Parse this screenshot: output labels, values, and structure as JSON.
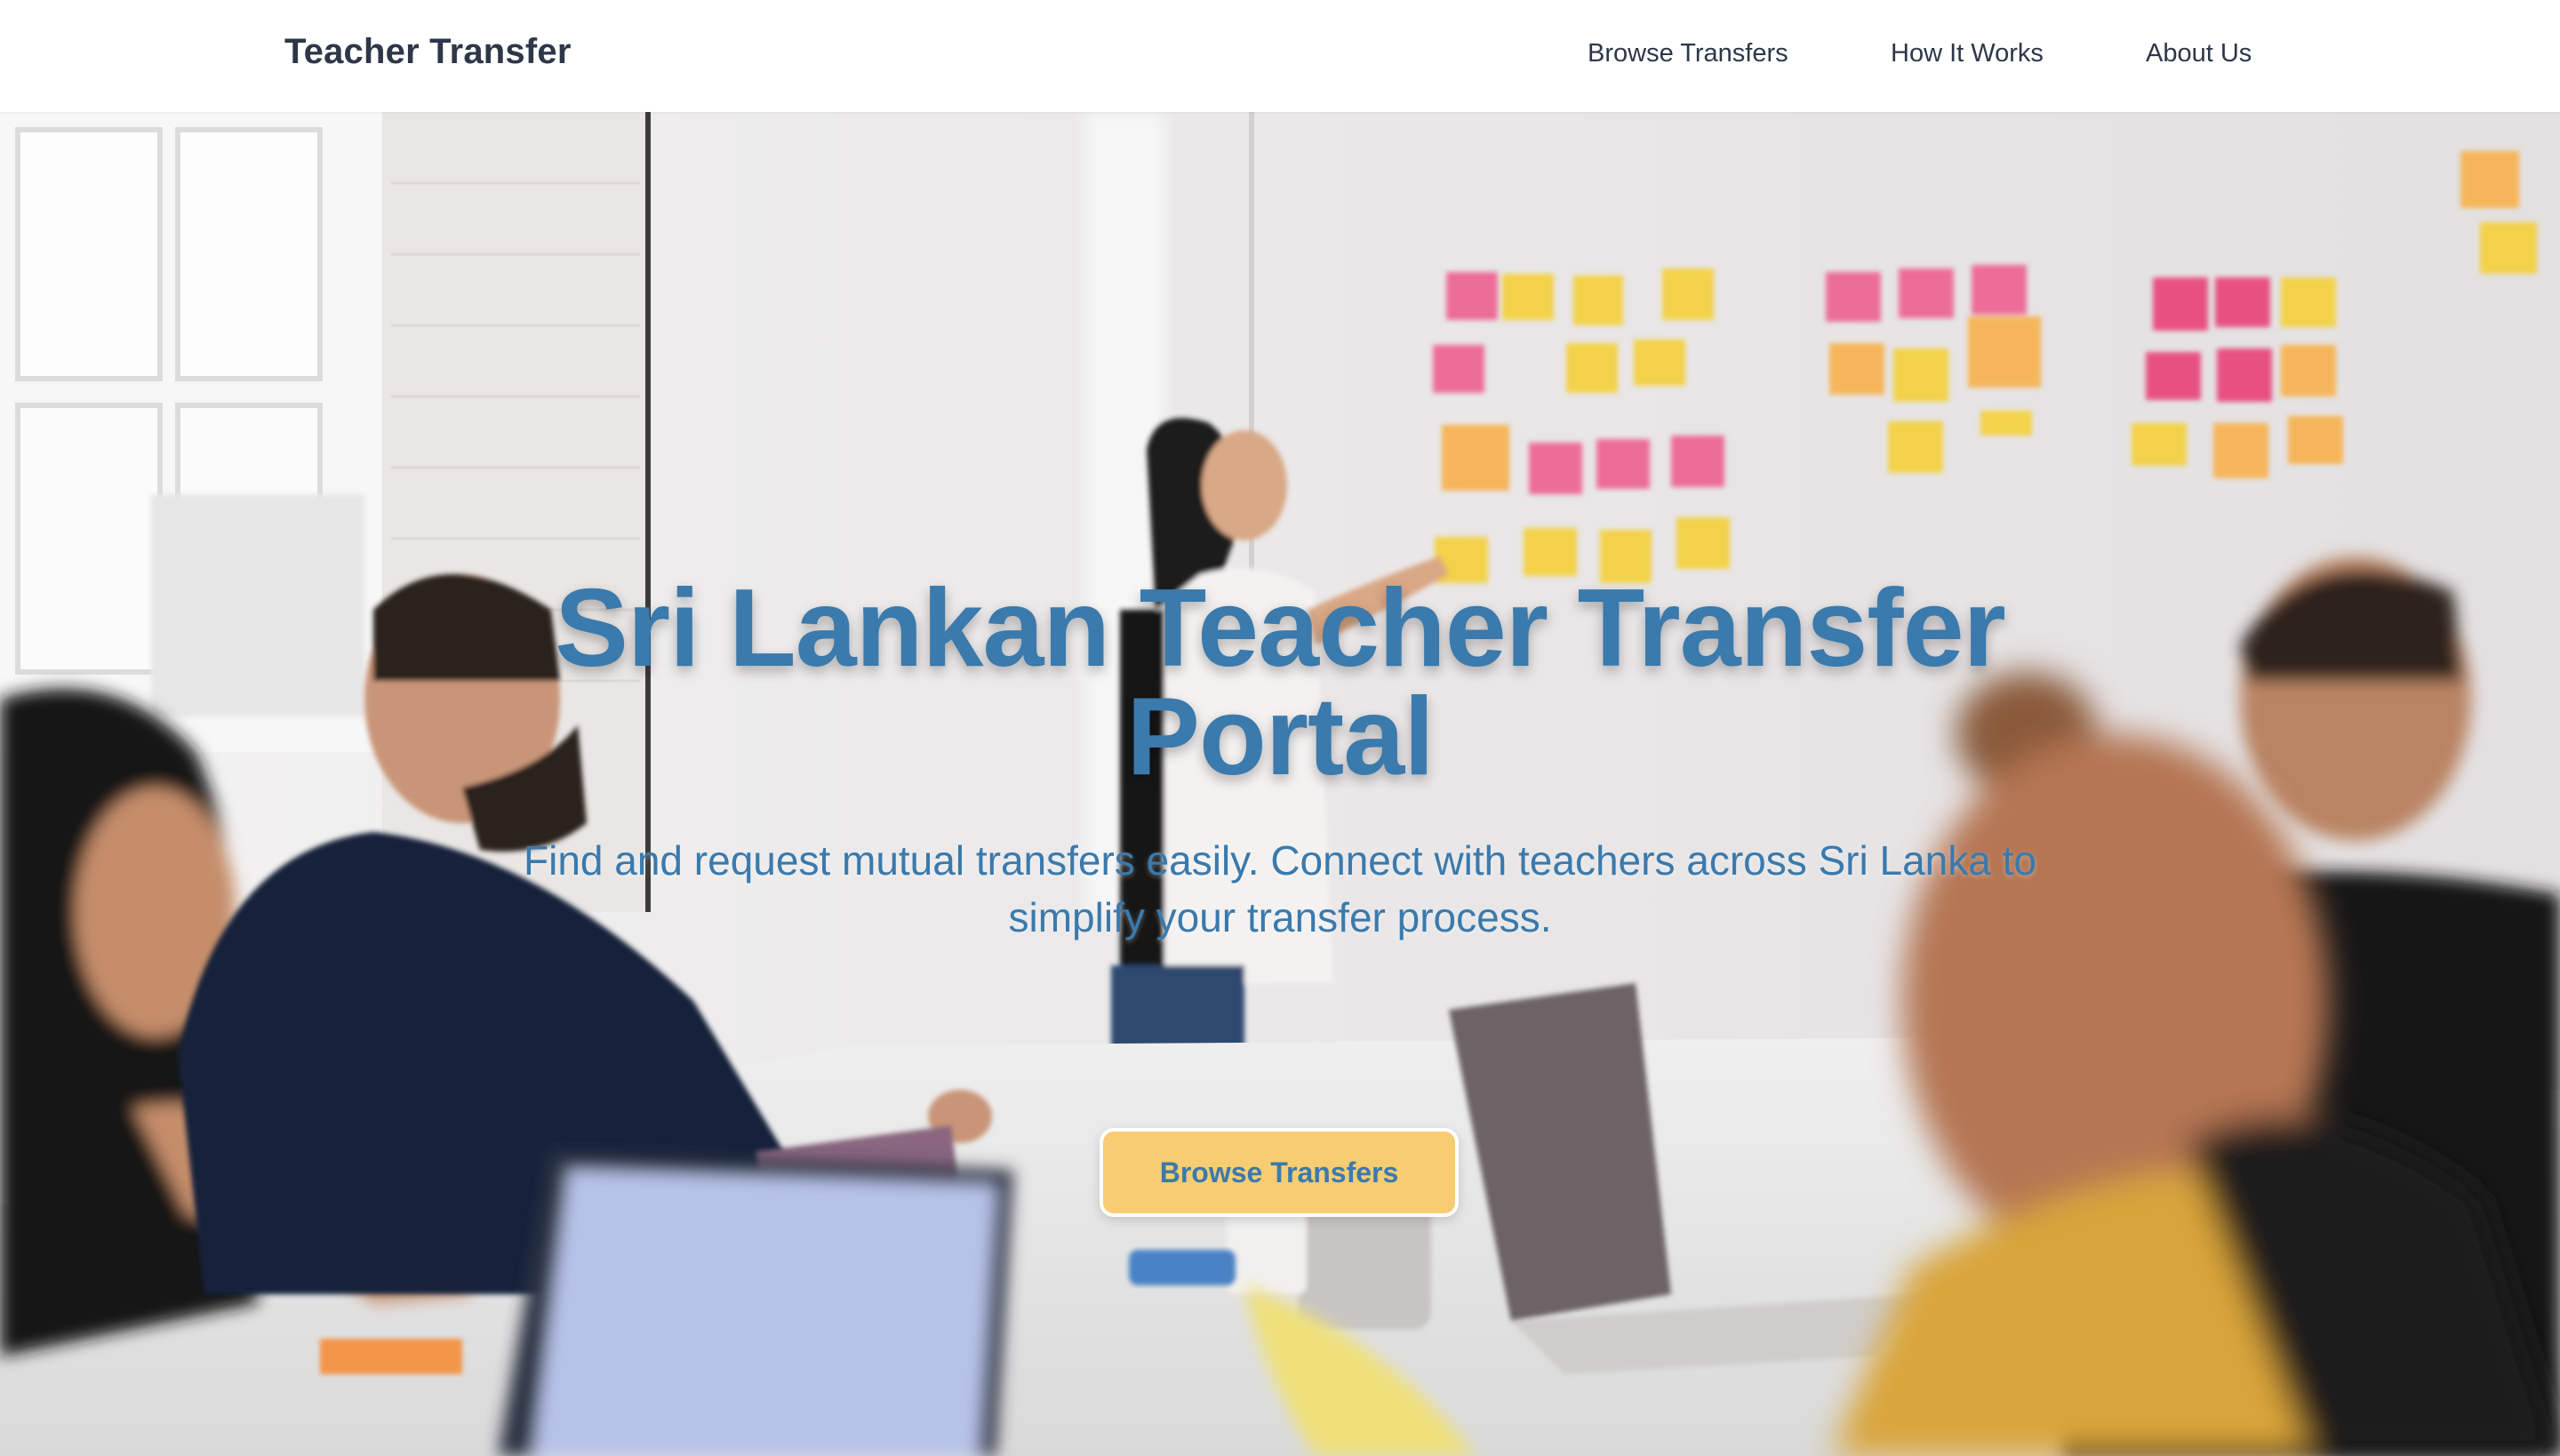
{
  "header": {
    "brand": "Teacher Transfer",
    "nav": [
      {
        "label": "Browse Transfers"
      },
      {
        "label": "How It Works"
      },
      {
        "label": "About Us"
      }
    ]
  },
  "hero": {
    "title": "Sri Lankan Teacher Transfer Portal",
    "subtitle": "Find and request mutual transfers easily. Connect with teachers across Sri Lanka to simplify your transfer process.",
    "cta_label": "Browse Transfers",
    "background": "office-meeting-sticky-notes-photo"
  },
  "colors": {
    "brand_text": "#2d3748",
    "hero_text": "#3a7aad",
    "cta_background": "#f7cc73",
    "header_background": "#ffffff"
  }
}
